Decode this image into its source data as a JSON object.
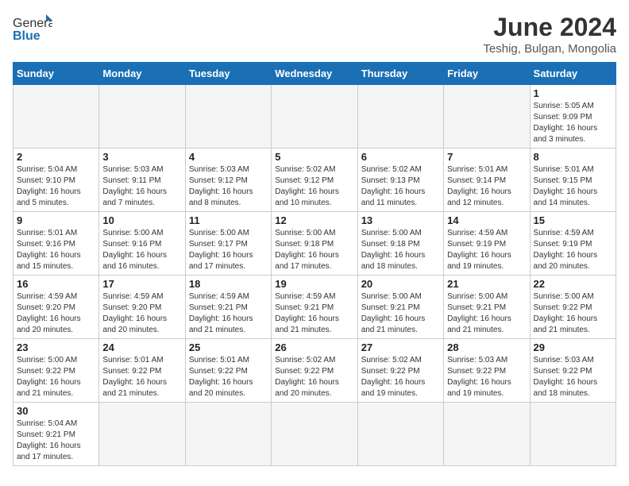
{
  "header": {
    "logo_general": "General",
    "logo_blue": "Blue",
    "month_year": "June 2024",
    "location": "Teshig, Bulgan, Mongolia"
  },
  "weekdays": [
    "Sunday",
    "Monday",
    "Tuesday",
    "Wednesday",
    "Thursday",
    "Friday",
    "Saturday"
  ],
  "weeks": [
    [
      {
        "day": "",
        "info": ""
      },
      {
        "day": "",
        "info": ""
      },
      {
        "day": "",
        "info": ""
      },
      {
        "day": "",
        "info": ""
      },
      {
        "day": "",
        "info": ""
      },
      {
        "day": "",
        "info": ""
      },
      {
        "day": "1",
        "info": "Sunrise: 5:05 AM\nSunset: 9:09 PM\nDaylight: 16 hours\nand 3 minutes."
      }
    ],
    [
      {
        "day": "2",
        "info": "Sunrise: 5:04 AM\nSunset: 9:10 PM\nDaylight: 16 hours\nand 5 minutes."
      },
      {
        "day": "3",
        "info": "Sunrise: 5:03 AM\nSunset: 9:11 PM\nDaylight: 16 hours\nand 7 minutes."
      },
      {
        "day": "4",
        "info": "Sunrise: 5:03 AM\nSunset: 9:12 PM\nDaylight: 16 hours\nand 8 minutes."
      },
      {
        "day": "5",
        "info": "Sunrise: 5:02 AM\nSunset: 9:12 PM\nDaylight: 16 hours\nand 10 minutes."
      },
      {
        "day": "6",
        "info": "Sunrise: 5:02 AM\nSunset: 9:13 PM\nDaylight: 16 hours\nand 11 minutes."
      },
      {
        "day": "7",
        "info": "Sunrise: 5:01 AM\nSunset: 9:14 PM\nDaylight: 16 hours\nand 12 minutes."
      },
      {
        "day": "8",
        "info": "Sunrise: 5:01 AM\nSunset: 9:15 PM\nDaylight: 16 hours\nand 14 minutes."
      }
    ],
    [
      {
        "day": "9",
        "info": "Sunrise: 5:01 AM\nSunset: 9:16 PM\nDaylight: 16 hours\nand 15 minutes."
      },
      {
        "day": "10",
        "info": "Sunrise: 5:00 AM\nSunset: 9:16 PM\nDaylight: 16 hours\nand 16 minutes."
      },
      {
        "day": "11",
        "info": "Sunrise: 5:00 AM\nSunset: 9:17 PM\nDaylight: 16 hours\nand 17 minutes."
      },
      {
        "day": "12",
        "info": "Sunrise: 5:00 AM\nSunset: 9:18 PM\nDaylight: 16 hours\nand 17 minutes."
      },
      {
        "day": "13",
        "info": "Sunrise: 5:00 AM\nSunset: 9:18 PM\nDaylight: 16 hours\nand 18 minutes."
      },
      {
        "day": "14",
        "info": "Sunrise: 4:59 AM\nSunset: 9:19 PM\nDaylight: 16 hours\nand 19 minutes."
      },
      {
        "day": "15",
        "info": "Sunrise: 4:59 AM\nSunset: 9:19 PM\nDaylight: 16 hours\nand 20 minutes."
      }
    ],
    [
      {
        "day": "16",
        "info": "Sunrise: 4:59 AM\nSunset: 9:20 PM\nDaylight: 16 hours\nand 20 minutes."
      },
      {
        "day": "17",
        "info": "Sunrise: 4:59 AM\nSunset: 9:20 PM\nDaylight: 16 hours\nand 20 minutes."
      },
      {
        "day": "18",
        "info": "Sunrise: 4:59 AM\nSunset: 9:21 PM\nDaylight: 16 hours\nand 21 minutes."
      },
      {
        "day": "19",
        "info": "Sunrise: 4:59 AM\nSunset: 9:21 PM\nDaylight: 16 hours\nand 21 minutes."
      },
      {
        "day": "20",
        "info": "Sunrise: 5:00 AM\nSunset: 9:21 PM\nDaylight: 16 hours\nand 21 minutes."
      },
      {
        "day": "21",
        "info": "Sunrise: 5:00 AM\nSunset: 9:21 PM\nDaylight: 16 hours\nand 21 minutes."
      },
      {
        "day": "22",
        "info": "Sunrise: 5:00 AM\nSunset: 9:22 PM\nDaylight: 16 hours\nand 21 minutes."
      }
    ],
    [
      {
        "day": "23",
        "info": "Sunrise: 5:00 AM\nSunset: 9:22 PM\nDaylight: 16 hours\nand 21 minutes."
      },
      {
        "day": "24",
        "info": "Sunrise: 5:01 AM\nSunset: 9:22 PM\nDaylight: 16 hours\nand 21 minutes."
      },
      {
        "day": "25",
        "info": "Sunrise: 5:01 AM\nSunset: 9:22 PM\nDaylight: 16 hours\nand 20 minutes."
      },
      {
        "day": "26",
        "info": "Sunrise: 5:02 AM\nSunset: 9:22 PM\nDaylight: 16 hours\nand 20 minutes."
      },
      {
        "day": "27",
        "info": "Sunrise: 5:02 AM\nSunset: 9:22 PM\nDaylight: 16 hours\nand 19 minutes."
      },
      {
        "day": "28",
        "info": "Sunrise: 5:03 AM\nSunset: 9:22 PM\nDaylight: 16 hours\nand 19 minutes."
      },
      {
        "day": "29",
        "info": "Sunrise: 5:03 AM\nSunset: 9:22 PM\nDaylight: 16 hours\nand 18 minutes."
      }
    ],
    [
      {
        "day": "30",
        "info": "Sunrise: 5:04 AM\nSunset: 9:21 PM\nDaylight: 16 hours\nand 17 minutes."
      },
      {
        "day": "",
        "info": ""
      },
      {
        "day": "",
        "info": ""
      },
      {
        "day": "",
        "info": ""
      },
      {
        "day": "",
        "info": ""
      },
      {
        "day": "",
        "info": ""
      },
      {
        "day": "",
        "info": ""
      }
    ]
  ]
}
